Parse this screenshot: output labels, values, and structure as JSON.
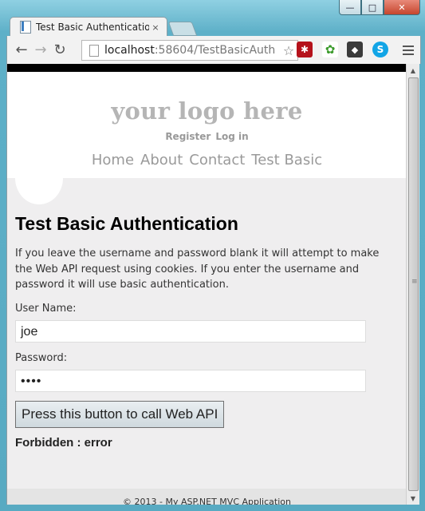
{
  "window": {
    "minimize": "—",
    "maximize": "□",
    "close": "✕"
  },
  "tab": {
    "title": "Test Basic Authentication",
    "close": "×"
  },
  "toolbar": {
    "back": "←",
    "forward": "→",
    "reload": "↻",
    "url_host": "localhost",
    "url_rest": ":58604/TestBasicAuth",
    "star": "☆",
    "ext1": "✱",
    "ext2": "✿",
    "ext3": "◆",
    "ext4": "S"
  },
  "site": {
    "logo": "your logo here",
    "register": "Register",
    "login": "Log in",
    "nav": [
      "Home",
      "About",
      "Contact",
      "Test Basic"
    ]
  },
  "main": {
    "heading": "Test Basic Authentication",
    "description": "If you leave the username and password blank it will attempt to make the Web API request using cookies. If you enter the username and password it will use basic authentication.",
    "username_label": "User Name:",
    "username_value": "joe",
    "password_label": "Password:",
    "password_value": "••••",
    "button_label": "Press this button to call Web API",
    "result": "Forbidden : error"
  },
  "footer": {
    "text": "© 2013 - My ASP.NET MVC Application"
  },
  "scrollbar": {
    "up": "▲",
    "down": "▼",
    "grip": "≡"
  }
}
